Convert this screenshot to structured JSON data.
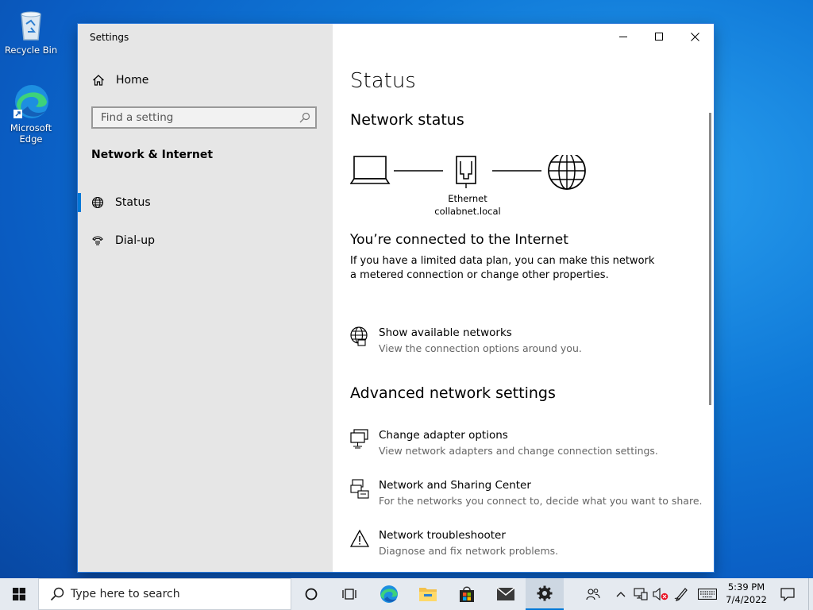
{
  "desktop": {
    "icons": [
      {
        "label": "Recycle Bin"
      },
      {
        "label": "Microsoft Edge"
      }
    ]
  },
  "window": {
    "title": "Settings",
    "controls": {
      "minimize": "minimize",
      "maximize": "maximize",
      "close": "close"
    }
  },
  "sidebar": {
    "home_label": "Home",
    "search_placeholder": "Find a setting",
    "search_value": "",
    "section_heading": "Network & Internet",
    "items": [
      {
        "label": "Status",
        "icon": "globe-icon",
        "selected": true
      },
      {
        "label": "Dial-up",
        "icon": "dialup-phone-icon",
        "selected": false
      }
    ]
  },
  "main": {
    "title": "Status",
    "network_status_heading": "Network status",
    "diagram": {
      "adapter_name": "Ethernet",
      "network_name": "collabnet.local"
    },
    "connected_heading": "You’re connected to the Internet",
    "connected_description": "If you have a limited data plan, you can make this network a metered connection or change other properties.",
    "show_networks": {
      "title": "Show available networks",
      "subtitle": "View the connection options around you."
    },
    "advanced_heading": "Advanced network settings",
    "advanced_items": [
      {
        "title": "Change adapter options",
        "subtitle": "View network adapters and change connection settings.",
        "icon": "adapter-icon"
      },
      {
        "title": "Network and Sharing Center",
        "subtitle": "For the networks you connect to, decide what you want to share.",
        "icon": "sharing-center-icon"
      },
      {
        "title": "Network troubleshooter",
        "subtitle": "Diagnose and fix network problems.",
        "icon": "warning-icon"
      }
    ]
  },
  "taskbar": {
    "search_placeholder": "Type here to search",
    "clock_time": "5:39 PM",
    "clock_date": "7/4/2022",
    "accent_color": "#0078d7"
  }
}
